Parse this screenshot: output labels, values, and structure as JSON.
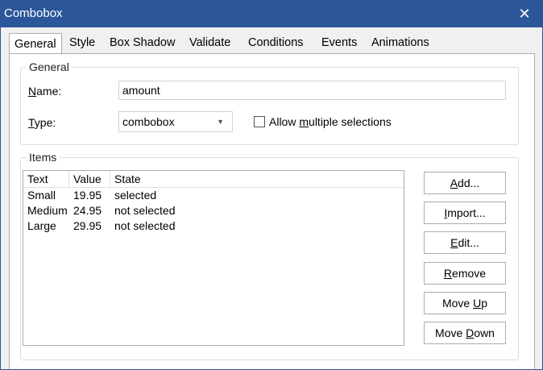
{
  "window": {
    "title": "Combobox"
  },
  "tabs": [
    {
      "label": "General"
    },
    {
      "label": "Style"
    },
    {
      "label": "Box Shadow"
    },
    {
      "label": "Validate"
    },
    {
      "label": "Conditions"
    },
    {
      "label": "Events"
    },
    {
      "label": "Animations"
    }
  ],
  "general": {
    "legend": "General",
    "name_label_pre": "",
    "name_label_u": "N",
    "name_label_post": "ame:",
    "name_value": "amount",
    "type_label_u": "T",
    "type_label_post": "ype:",
    "type_value": "combobox",
    "allow_pre": "Allow ",
    "allow_u": "m",
    "allow_post": "ultiple selections",
    "allow_checked": false
  },
  "items": {
    "legend": "Items",
    "columns": [
      "Text",
      "Value",
      "State"
    ],
    "rows": [
      {
        "text": "Small",
        "value": "19.95",
        "state": "selected"
      },
      {
        "text": "Medium",
        "value": "24.95",
        "state": "not selected"
      },
      {
        "text": "Large",
        "value": "29.95",
        "state": "not selected"
      }
    ]
  },
  "buttons": {
    "add": {
      "pre": "",
      "u": "A",
      "post": "dd..."
    },
    "import": {
      "pre": "",
      "u": "I",
      "post": "mport..."
    },
    "edit": {
      "pre": "",
      "u": "E",
      "post": "dit..."
    },
    "remove": {
      "pre": "",
      "u": "R",
      "post": "emove"
    },
    "move_up": {
      "pre": "Move ",
      "u": "U",
      "post": "p"
    },
    "move_down": {
      "pre": "Move ",
      "u": "D",
      "post": "own"
    }
  },
  "icons": {
    "close": "close-icon",
    "dropdown": "chevron-down-icon"
  },
  "colors": {
    "titlebar": "#2b579a",
    "background": "#f0f0f0"
  }
}
